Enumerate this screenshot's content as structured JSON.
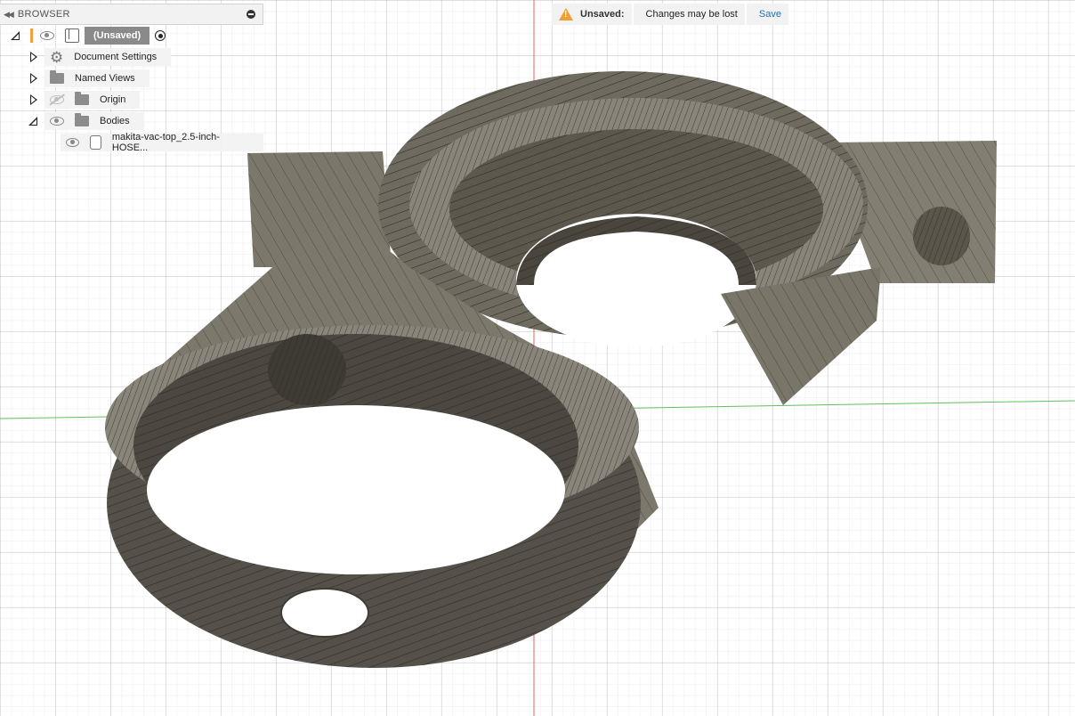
{
  "browser": {
    "title": "BROWSER",
    "root": {
      "label": "(Unsaved)"
    },
    "items": [
      {
        "label": "Document Settings",
        "icon": "gear-icon"
      },
      {
        "label": "Named Views",
        "icon": "folder-icon"
      },
      {
        "label": "Origin",
        "icon": "folder-icon",
        "visible": false
      },
      {
        "label": "Bodies",
        "icon": "folder-icon",
        "expanded": true
      }
    ],
    "body_item": {
      "label": "makita-vac-top_2.5-inch-HOSE..."
    }
  },
  "banner": {
    "title": "Unsaved:",
    "message": "Changes may be lost",
    "save_label": "Save"
  },
  "colors": {
    "model_fill": "#7f7a6e",
    "model_dark": "#3d3a33",
    "accent_orange": "#f0a040",
    "link_blue": "#1f6fb8"
  }
}
